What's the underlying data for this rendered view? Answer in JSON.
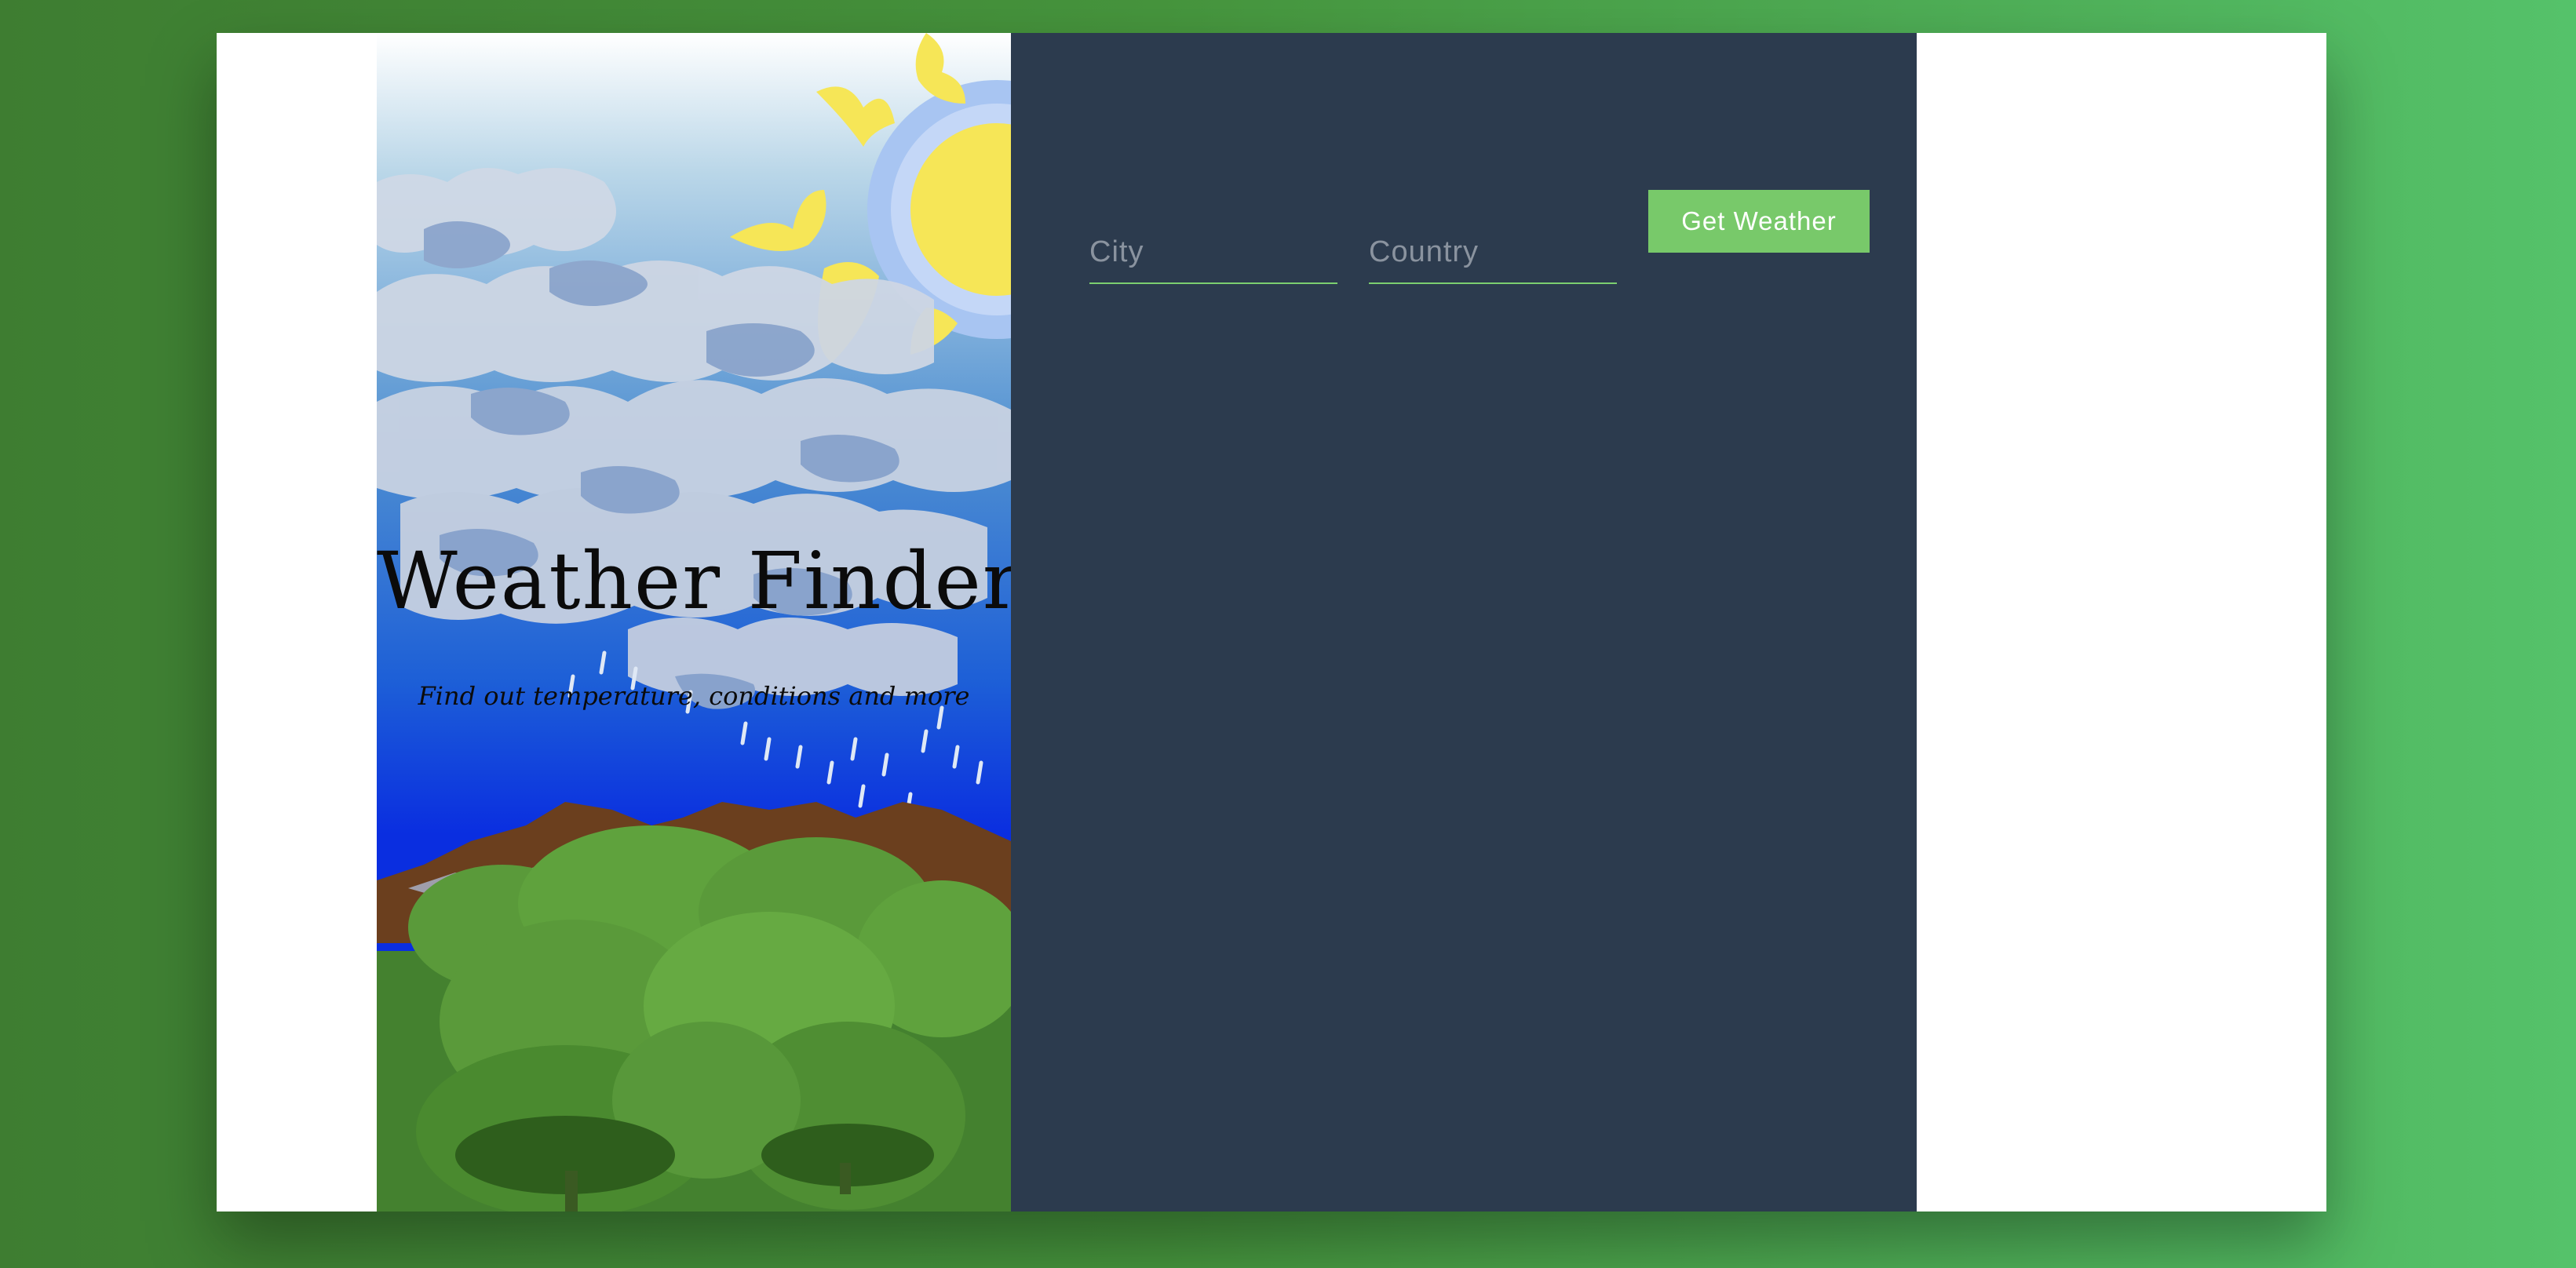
{
  "hero": {
    "title": "Weather Finder",
    "subtitle": "Find out temperature, conditions and more"
  },
  "form": {
    "city_placeholder": "City",
    "country_placeholder": "Country",
    "submit_label": "Get Weather",
    "city_value": "",
    "country_value": ""
  },
  "colors": {
    "background_start": "#3e7d31",
    "background_end": "#55c26a",
    "panel": "#2c3b4e",
    "accent": "#78c96a",
    "field_underline": "#7ccf6f"
  },
  "icons": {
    "hero_illustration": "weather-landscape-illustration"
  }
}
